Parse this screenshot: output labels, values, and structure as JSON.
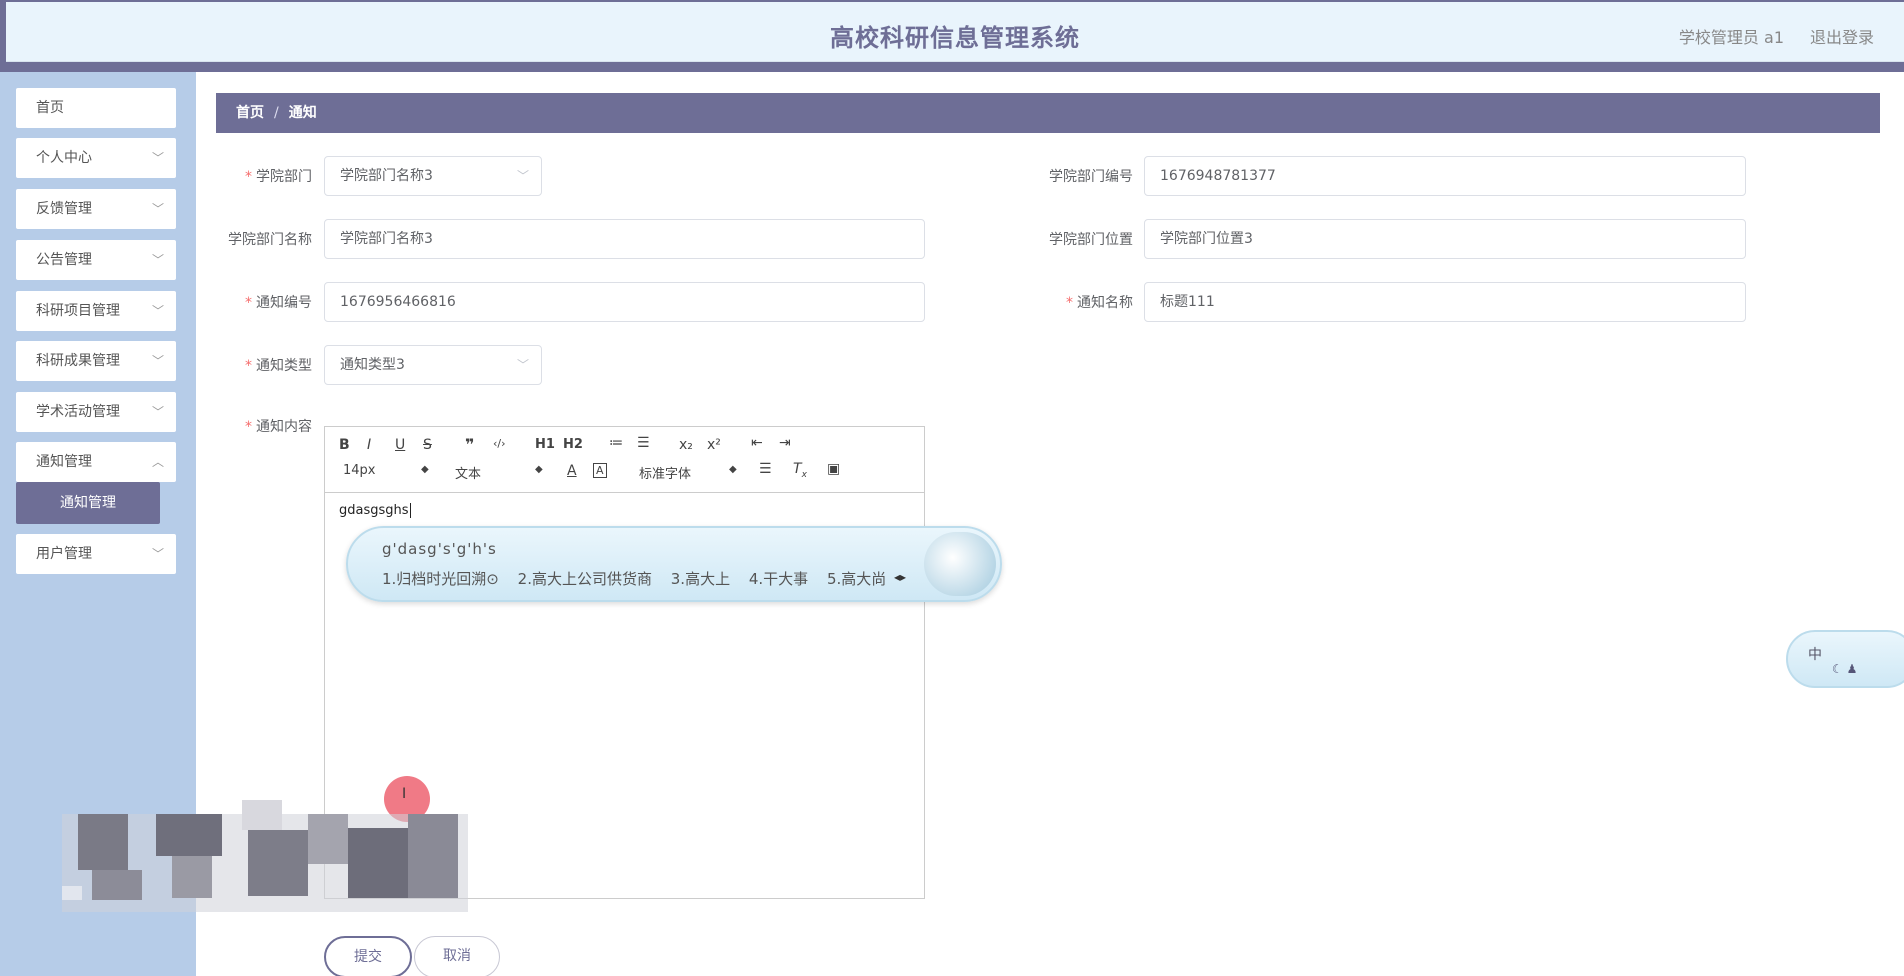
{
  "header": {
    "title": "高校科研信息管理系统",
    "user": "学校管理员 a1",
    "logout": "退出登录"
  },
  "sidebar": {
    "items": [
      {
        "label": "首页",
        "has_children": false
      },
      {
        "label": "个人中心",
        "has_children": true
      },
      {
        "label": "反馈管理",
        "has_children": true
      },
      {
        "label": "公告管理",
        "has_children": true
      },
      {
        "label": "科研项目管理",
        "has_children": true
      },
      {
        "label": "科研成果管理",
        "has_children": true
      },
      {
        "label": "学术活动管理",
        "has_children": true
      },
      {
        "label": "通知管理",
        "has_children": true,
        "expanded": true
      },
      {
        "label": "用户管理",
        "has_children": true
      }
    ],
    "submenu_active": "通知管理"
  },
  "breadcrumb": {
    "home": "首页",
    "separator": "/",
    "current": "通知"
  },
  "form": {
    "dept": {
      "label": "学院部门",
      "required": true,
      "value": "学院部门名称3"
    },
    "dept_code": {
      "label": "学院部门编号",
      "required": false,
      "value": "1676948781377"
    },
    "dept_name": {
      "label": "学院部门名称",
      "required": false,
      "value": "学院部门名称3"
    },
    "dept_location": {
      "label": "学院部门位置",
      "required": false,
      "value": "学院部门位置3"
    },
    "notice_code": {
      "label": "通知编号",
      "required": true,
      "value": "1676956466816"
    },
    "notice_name": {
      "label": "通知名称",
      "required": true,
      "value": "标题111"
    },
    "notice_type": {
      "label": "通知类型",
      "required": true,
      "value": "通知类型3"
    },
    "notice_content": {
      "label": "通知内容",
      "required": true
    }
  },
  "editor": {
    "toolbar_row1": [
      "B",
      "I",
      "U",
      "S",
      "❞",
      "‹/›",
      "H1",
      "H2",
      "≔",
      "☰",
      "x₂",
      "x²",
      "⇤",
      "⇥"
    ],
    "font_size": "14px",
    "text_style": "文本",
    "font_family": "标准字体",
    "content": "gdasgsghs"
  },
  "ime": {
    "composition": "g'dasg's'g'h's",
    "candidates": [
      "1.归档时光回溯⊙",
      "2.高大上公司供货商",
      "3.高大上",
      "4.干大事",
      "5.高大尚"
    ],
    "mini_label": "中"
  },
  "buttons": {
    "submit": "提交",
    "cancel": "取消"
  },
  "cursor": {
    "glyph": "I"
  },
  "colors": {
    "primary": "#6e6e96",
    "sidebar_bg": "#b6cce8",
    "header_bg": "#e9f4fc",
    "required": "#f56c6c"
  }
}
